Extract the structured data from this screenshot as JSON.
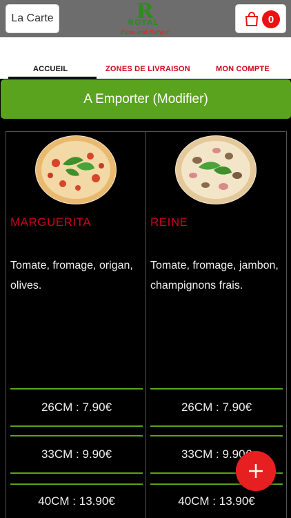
{
  "header": {
    "carte_label": "La Carte",
    "logo_letter": "R",
    "logo_word": "ROYAL",
    "logo_sub": "Pizza and Burger",
    "cart_count": "0"
  },
  "nav": {
    "tabs": [
      "ACCUEIL",
      "ZONES DE LIVRAISON",
      "MON COMPTE"
    ]
  },
  "mode_button": "A Emporter (Modifier)",
  "products": [
    {
      "name": "MARGUERITA",
      "description": "Tomate, fromage, origan, olives.",
      "prices": [
        "26CM : 7.90€",
        "33CM : 9.90€",
        "40CM : 13.90€"
      ]
    },
    {
      "name": "REINE",
      "description": "Tomate, fromage, jambon, champignons frais.",
      "prices": [
        "26CM : 7.90€",
        "33CM : 9.90€",
        "40CM : 13.90€"
      ]
    }
  ],
  "colors": {
    "accent_green": "#5aa31e",
    "accent_red": "#d0021b",
    "background": "#000000"
  },
  "icons": [
    "shopping-bag-icon",
    "plus-icon"
  ]
}
